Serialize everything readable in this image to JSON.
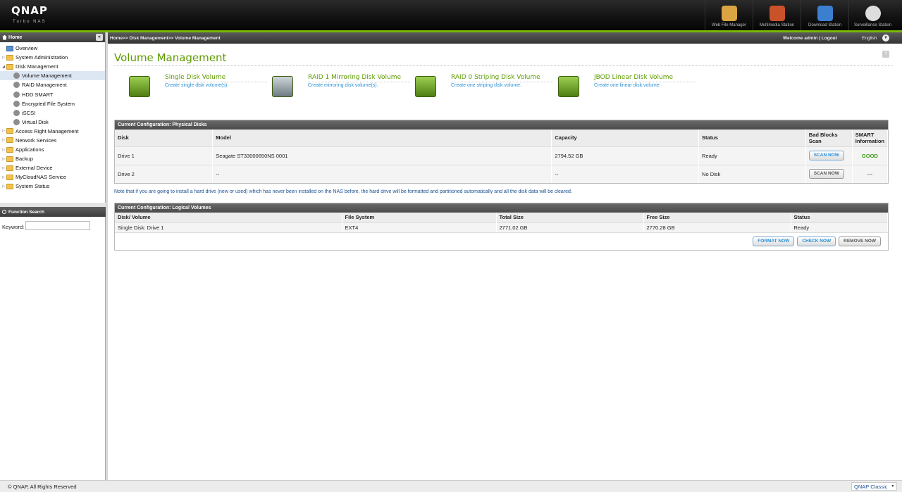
{
  "header": {
    "logo": "QNAP",
    "logo_sub": "Turbo NAS",
    "apps": [
      {
        "label": "Web File Manager",
        "icon": "folder-search-icon",
        "color": "#d9a441"
      },
      {
        "label": "Multimedia Station",
        "icon": "film-icon",
        "color": "#c9522a"
      },
      {
        "label": "Download Station",
        "icon": "download-globe-icon",
        "color": "#3c7fd0"
      },
      {
        "label": "Surveillance Station",
        "icon": "camera-icon",
        "color": "#dddddd"
      }
    ],
    "accent": "#7ab800"
  },
  "sidebar": {
    "title": "Home",
    "collapse": "«",
    "items": [
      {
        "label": "Overview"
      },
      {
        "label": "System Administration"
      },
      {
        "label": "Disk Management"
      },
      {
        "label": "Volume Management"
      },
      {
        "label": "RAID Management"
      },
      {
        "label": "HDD SMART"
      },
      {
        "label": "Encrypted File System"
      },
      {
        "label": "iSCSI"
      },
      {
        "label": "Virtual Disk"
      },
      {
        "label": "Access Right Management"
      },
      {
        "label": "Network Services"
      },
      {
        "label": "Applications"
      },
      {
        "label": "Backup"
      },
      {
        "label": "External Device"
      },
      {
        "label": "MyCloudNAS Service"
      },
      {
        "label": "System Status"
      }
    ],
    "function_search": "Function Search",
    "keyword_label": "Keyword:",
    "keyword_value": ""
  },
  "topbar": {
    "breadcrumb": "Home>> Disk Management>> Volume Management",
    "welcome": "Welcome admin | Logout",
    "language": "English"
  },
  "main": {
    "title": "Volume Management",
    "volume_types": [
      {
        "title": "Single Disk Volume",
        "desc": "Create single disk volume(s)."
      },
      {
        "title": "RAID 1 Mirroring Disk Volume",
        "desc": "Create mirroring disk volume(s)."
      },
      {
        "title": "RAID 0 Striping Disk Volume",
        "desc": "Create one striping disk volume."
      },
      {
        "title": "JBOD Linear Disk Volume",
        "desc": "Create one linear disk volume."
      }
    ],
    "physical": {
      "title": "Current Configuration: Physical Disks",
      "headers": [
        "Disk",
        "Model",
        "Capacity",
        "Status",
        "Bad Blocks Scan",
        "SMART Information"
      ],
      "rows": [
        {
          "disk": "Drive 1",
          "model": "Seagate ST33000650NS 0001",
          "capacity": "2794.52 GB",
          "status": "Ready",
          "scan": "SCAN NOW",
          "smart": "GOOD"
        },
        {
          "disk": "Drive 2",
          "model": "--",
          "capacity": "--",
          "status": "No Disk",
          "scan": "SCAN NOW",
          "smart": "---"
        }
      ]
    },
    "note": "Note that if you are going to install a hard drive (new or used) which has never been installed on the NAS before, the hard drive will be formatted and partitioned automatically and all the disk data will be cleared.",
    "logical": {
      "title": "Current Configuration: Logical Volumes",
      "headers": [
        "Disk/ Volume",
        "File System",
        "Total Size",
        "Free Size",
        "Status"
      ],
      "rows": [
        {
          "volume": "Single Disk: Drive 1",
          "fs": "EXT4",
          "total": "2771.02 GB",
          "free": "2770.28 GB",
          "status": "Ready"
        }
      ],
      "buttons": {
        "format": "FORMAT NOW",
        "check": "CHECK NOW",
        "remove": "REMOVE NOW"
      }
    }
  },
  "footer": {
    "copyright": "© QNAP, All Rights Reserved",
    "theme": "QNAP Classic"
  }
}
